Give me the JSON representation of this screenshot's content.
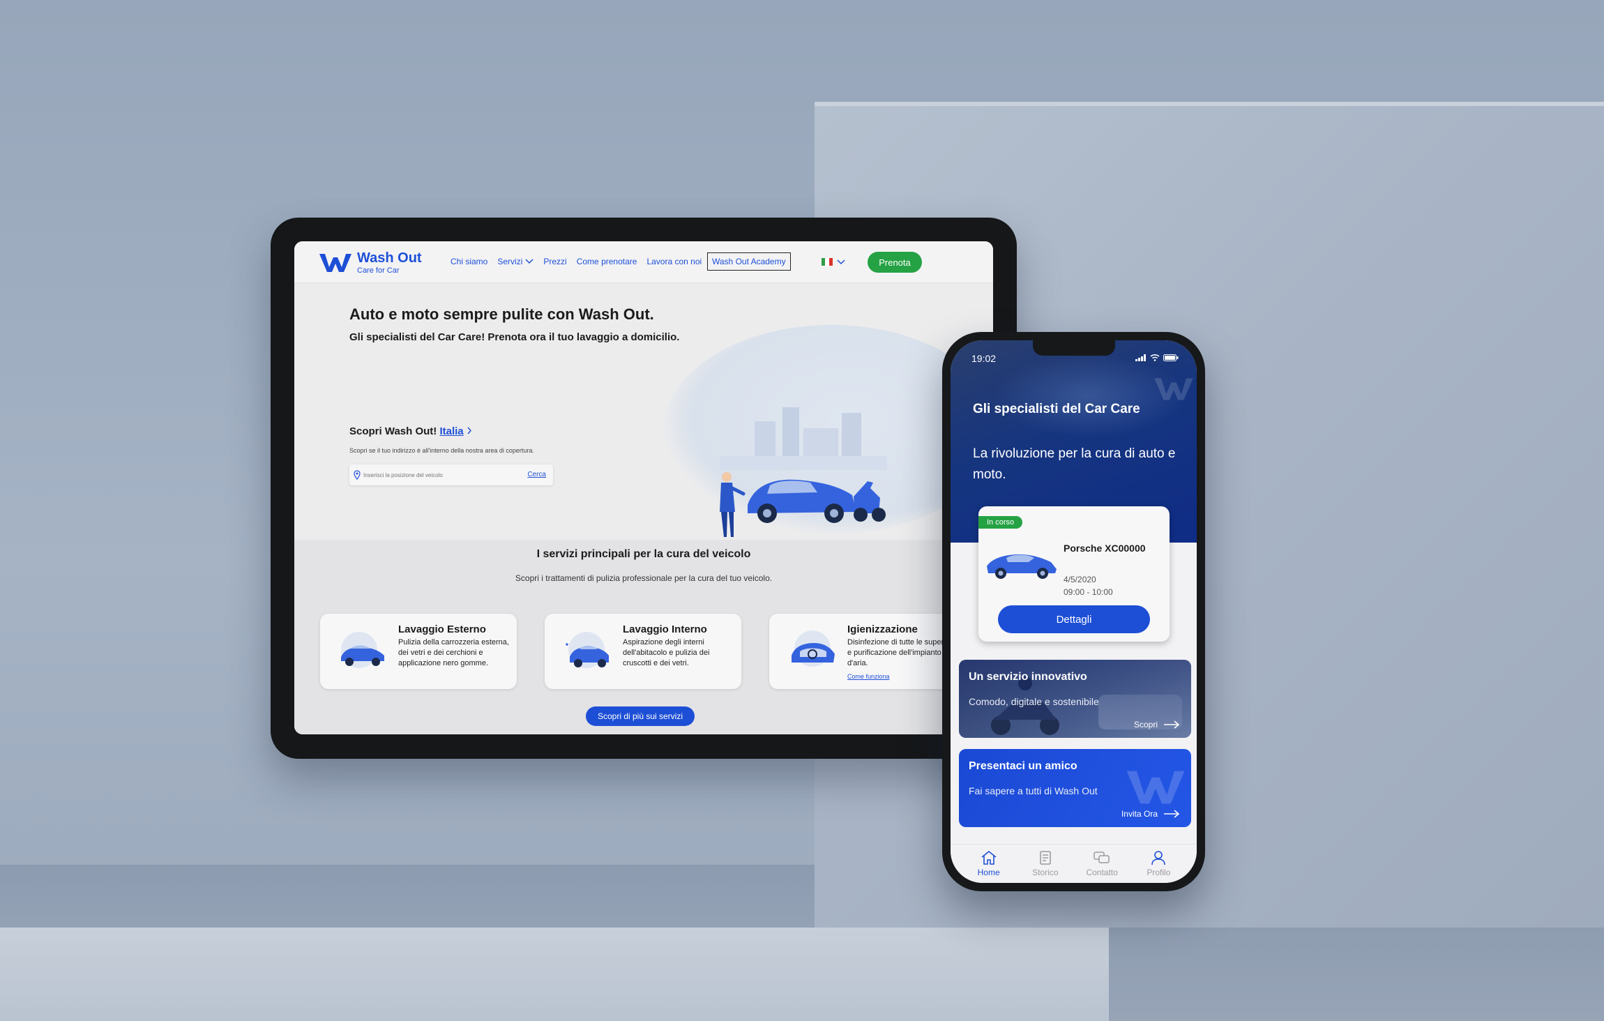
{
  "colors": {
    "brand_blue": "#1d4fd6",
    "book_green": "#25a244",
    "badge_green": "#25a244"
  },
  "website": {
    "logo": {
      "name": "Wash Out",
      "tagline": "Care for Car"
    },
    "nav": {
      "items": [
        "Chi siamo",
        "Servizi",
        "Prezzi",
        "Come prenotare",
        "Lavora con noi"
      ],
      "academy": "Wash Out Academy",
      "language_icon": "italy-flag-icon",
      "book": "Prenota"
    },
    "hero": {
      "title": "Auto e moto sempre pulite con Wash Out.",
      "subtitle": "Gli specialisti del Car Care! Prenota ora il tuo lavaggio a domicilio."
    },
    "discover": {
      "title": "Scopri Wash Out!",
      "link": "Italia",
      "help": "Scopri se il tuo indirizzo è all'interno della nostra area di copertura.",
      "search_placeholder": "Inserisci la posizione del veicolo",
      "search_button": "Cerca"
    },
    "services": {
      "title": "I servizi principali per la cura del veicolo",
      "subtitle": "Scopri i trattamenti di pulizia professionale per la cura del tuo veicolo.",
      "cards": [
        {
          "title": "Lavaggio Esterno",
          "text": "Pulizia della carrozzeria esterna, dei vetri e dei cerchioni e applicazione nero gomme."
        },
        {
          "title": "Lavaggio Interno",
          "text": "Aspirazione degli interni dell'abitacolo e pulizia dei cruscotti e dei vetri."
        },
        {
          "title": "Igienizzazione",
          "text": "Disinfezione di tutte le superfici e purificazione dell'impianto d'aria.",
          "link": "Come funziona"
        }
      ],
      "more_button": "Scopri di più sui servizi"
    }
  },
  "app": {
    "status_bar": {
      "time": "19:02"
    },
    "hero": {
      "title": "Gli specialisti del Car Care",
      "subtitle": "La rivoluzione per la cura di auto e moto."
    },
    "booking": {
      "status": "In corso",
      "vehicle": "Porsche XC00000",
      "date": "4/5/2020",
      "time": "09:00 - 10:00",
      "button": "Dettagli"
    },
    "promo_service": {
      "title": "Un servizio innovativo",
      "subtitle": "Comodo, digitale e sostenibile",
      "cta": "Scopri"
    },
    "promo_friend": {
      "title": "Presentaci un amico",
      "subtitle": "Fai sapere a tutti di Wash Out",
      "cta": "Invita Ora"
    },
    "tabs": [
      {
        "label": "Home",
        "icon": "home-icon"
      },
      {
        "label": "Storico",
        "icon": "history-icon"
      },
      {
        "label": "Contatto",
        "icon": "chat-icon"
      },
      {
        "label": "Profilo",
        "icon": "user-icon"
      }
    ]
  }
}
